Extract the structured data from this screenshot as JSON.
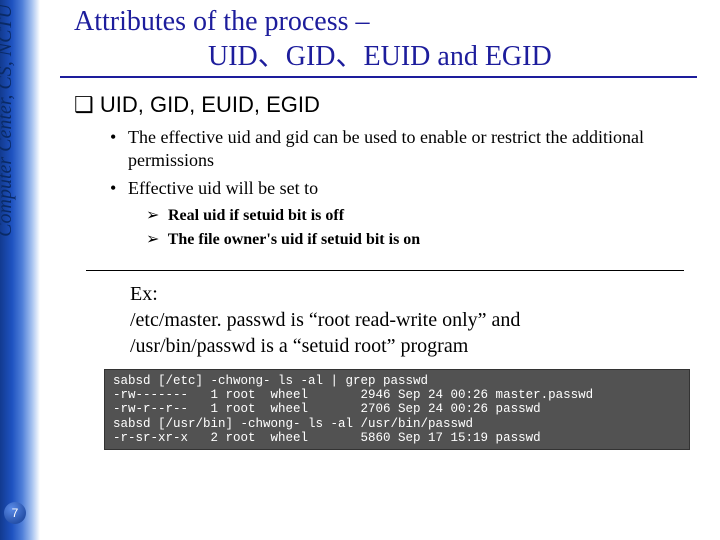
{
  "sidebar": {
    "label": "Computer Center, CS, NCTU"
  },
  "page_number": "7",
  "title": {
    "line1": "Attributes of the process –",
    "line2": "UID、GID、EUID and EGID"
  },
  "section": {
    "heading_marker": "❑",
    "heading": "UID, GID, EUID, EGID",
    "bullets": [
      {
        "marker": "•",
        "text": "The effective uid and gid can be used to enable or restrict the additional permissions"
      },
      {
        "marker": "•",
        "text": "Effective uid will be set to",
        "sub": [
          {
            "marker": "➢",
            "text": "Real uid if setuid bit is off"
          },
          {
            "marker": "➢",
            "text": "The file owner's uid if setuid bit is on"
          }
        ]
      }
    ]
  },
  "example": {
    "line1": "Ex:",
    "line2": "/etc/master. passwd is “root read-write only” and",
    "line3": "/usr/bin/passwd is a “setuid root” program"
  },
  "code": "sabsd [/etc] -chwong- ls -al | grep passwd\n-rw-------   1 root  wheel       2946 Sep 24 00:26 master.passwd\n-rw-r--r--   1 root  wheel       2706 Sep 24 00:26 passwd\nsabsd [/usr/bin] -chwong- ls -al /usr/bin/passwd\n-r-sr-xr-x   2 root  wheel       5860 Sep 17 15:19 passwd"
}
